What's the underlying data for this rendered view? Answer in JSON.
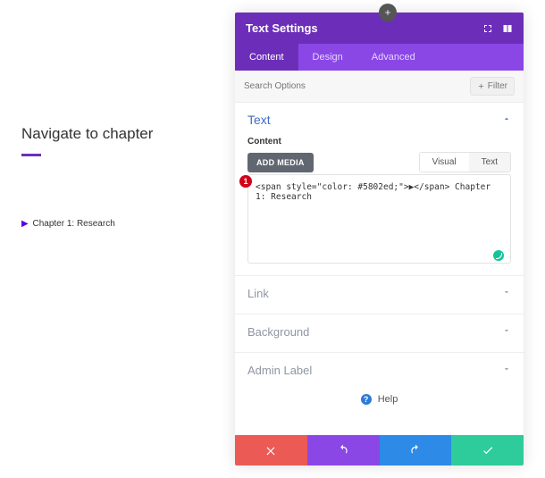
{
  "left": {
    "title": "Navigate to chapter",
    "chapter_label": "Chapter 1: Research"
  },
  "annotations": {
    "badge1": "1"
  },
  "panel": {
    "title": "Text Settings",
    "tabs": {
      "content": "Content",
      "design": "Design",
      "advanced": "Advanced"
    },
    "search_placeholder": "Search Options",
    "filter_label": "Filter",
    "sections": {
      "text": "Text",
      "link": "Link",
      "background": "Background",
      "admin_label": "Admin Label"
    },
    "content_label": "Content",
    "add_media": "ADD MEDIA",
    "visual_tab": "Visual",
    "text_tab": "Text",
    "editor_value": "<span style=\"color: #5802ed;\">▶</span> Chapter 1: Research",
    "help_label": "Help"
  },
  "icons": {
    "expand": "expand-icon",
    "pane": "pane-layout-icon",
    "plus": "plus-icon",
    "filter_plus": "plus-icon",
    "chev_up": "chevron-up-icon",
    "chev_down": "chevron-down-icon",
    "help": "help-icon",
    "cancel": "close-icon",
    "undo": "undo-icon",
    "redo": "redo-icon",
    "save": "check-icon",
    "grammarly": "grammarly-icon"
  },
  "colors": {
    "brand_purple": "#6c2eb9",
    "tab_purple": "#8b46e6",
    "link_blue": "#3f6bc7",
    "danger": "#eb5a55",
    "info": "#2d8ae6",
    "success": "#2ecc9b",
    "accent_text": "#5802ed",
    "badge_red": "#d0021b"
  }
}
